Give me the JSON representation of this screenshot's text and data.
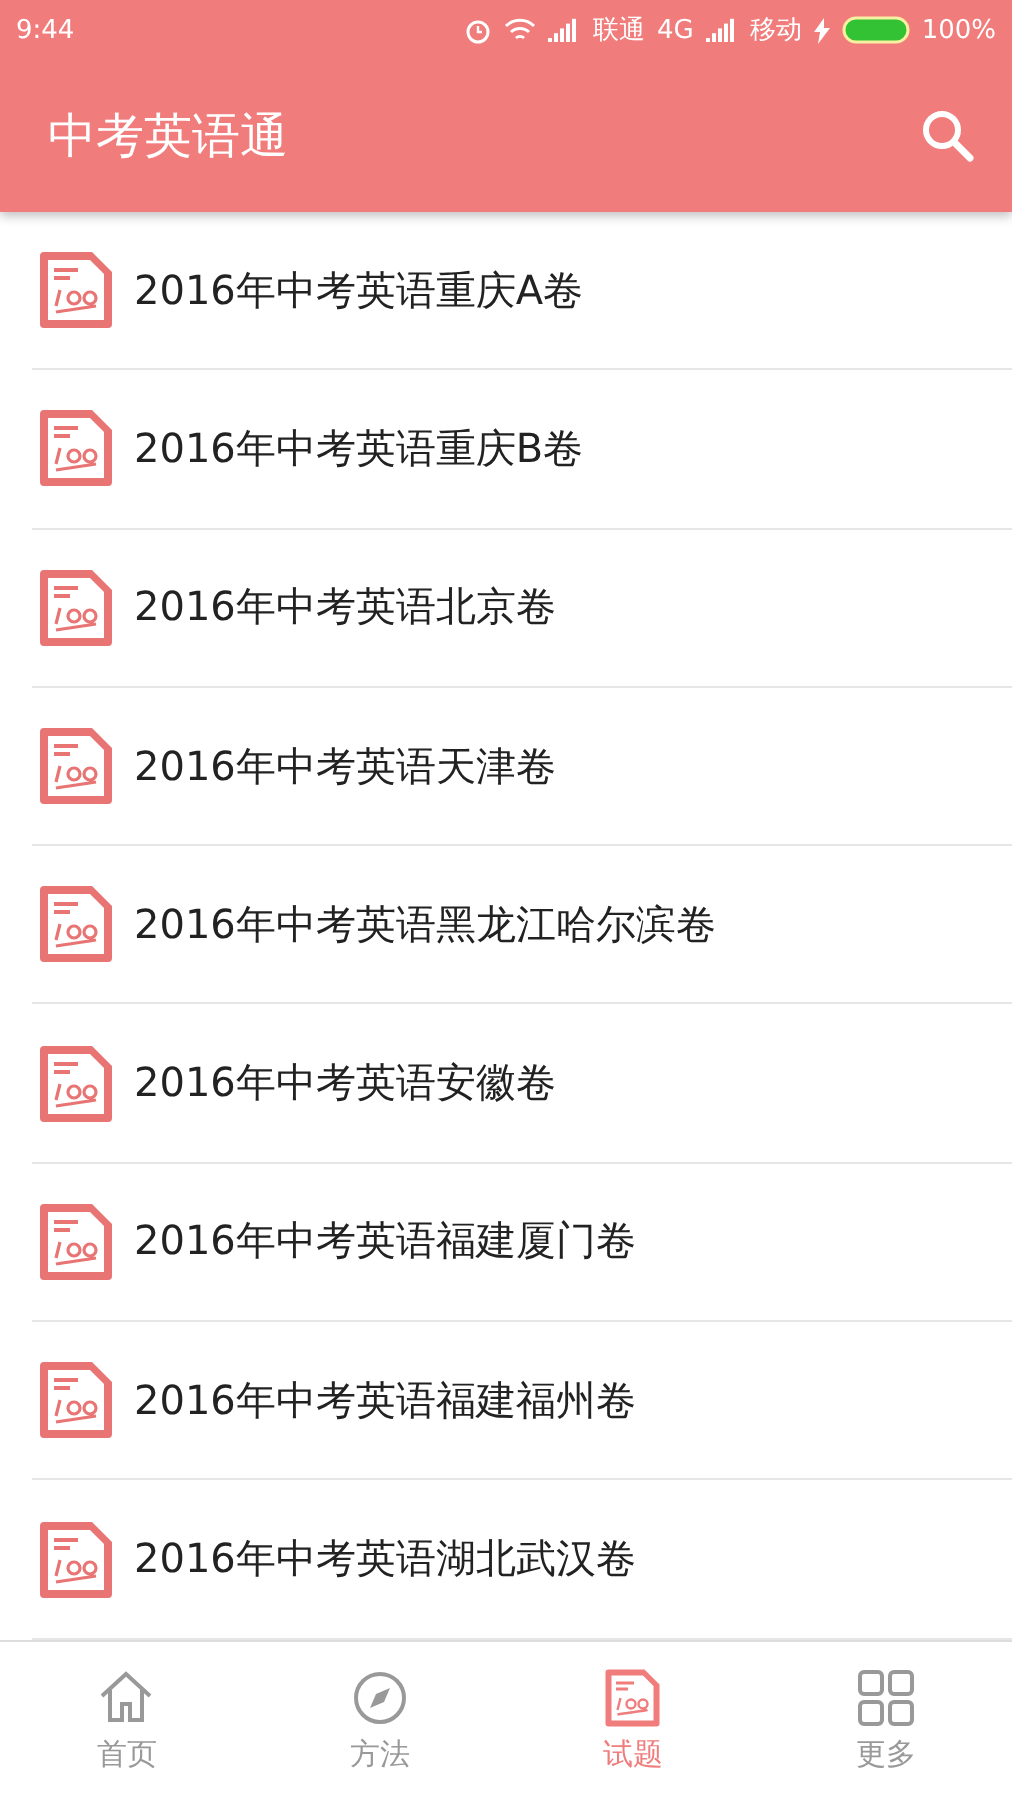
{
  "status_bar": {
    "time": "9:44",
    "carrier_1": "联通",
    "network_1": "4G",
    "carrier_2": "移动",
    "battery": "100%"
  },
  "app_bar": {
    "title": "中考英语通"
  },
  "papers": [
    {
      "title": "2016年中考英语重庆A卷"
    },
    {
      "title": "2016年中考英语重庆B卷"
    },
    {
      "title": "2016年中考英语北京卷"
    },
    {
      "title": "2016年中考英语天津卷"
    },
    {
      "title": "2016年中考英语黑龙江哈尔滨卷"
    },
    {
      "title": "2016年中考英语安徽卷"
    },
    {
      "title": "2016年中考英语福建厦门卷"
    },
    {
      "title": "2016年中考英语福建福州卷"
    },
    {
      "title": "2016年中考英语湖北武汉卷"
    }
  ],
  "bottom_nav": [
    {
      "label": "首页",
      "kind": "home",
      "selected": false
    },
    {
      "label": "方法",
      "kind": "method",
      "selected": false
    },
    {
      "label": "试题",
      "kind": "paper",
      "selected": true
    },
    {
      "label": "更多",
      "kind": "more",
      "selected": false
    }
  ]
}
